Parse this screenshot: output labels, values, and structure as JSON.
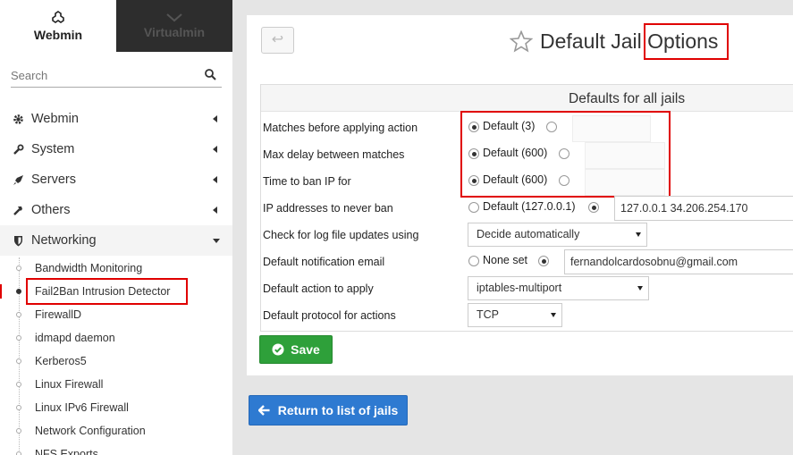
{
  "sidebar": {
    "switch": {
      "webmin_label": "Webmin",
      "virtualmin_label": "Virtualmin"
    },
    "search_placeholder": "Search",
    "menu": [
      {
        "label": "Webmin",
        "icon": "gear-icon"
      },
      {
        "label": "System",
        "icon": "wrench-icon"
      },
      {
        "label": "Servers",
        "icon": "rocket-icon"
      },
      {
        "label": "Others",
        "icon": "tools-icon"
      },
      {
        "label": "Networking",
        "icon": "shield-icon"
      }
    ],
    "submenu": [
      "Bandwidth Monitoring",
      "Fail2Ban Intrusion Detector",
      "FirewallD",
      "idmapd daemon",
      "Kerberos5",
      "Linux Firewall",
      "Linux IPv6 Firewall",
      "Network Configuration",
      "NFS Exports"
    ],
    "active_submenu": "Fail2Ban Intrusion Detector"
  },
  "header": {
    "back_icon": "↩",
    "title_part1": "Default Jail ",
    "title_part2": "Options"
  },
  "form": {
    "section_title": "Defaults for all jails",
    "rows": [
      {
        "label": "Matches before applying action",
        "default_option": "Default (3)",
        "selected": "default",
        "value": ""
      },
      {
        "label": "Max delay between matches",
        "default_option": "Default (600)",
        "selected": "default",
        "value": ""
      },
      {
        "label": "Time to ban IP for",
        "default_option": "Default (600)",
        "selected": "default",
        "value": ""
      },
      {
        "label": "IP addresses to never ban",
        "default_option": "Default (127.0.0.1)",
        "selected": "custom",
        "value": "127.0.0.1 34.206.254.170"
      },
      {
        "label": "Check for log file updates using",
        "select_value": "Decide automatically"
      },
      {
        "label": "Default notification email",
        "default_option": "None set",
        "selected": "custom",
        "value": "fernandolcardosobnu@gmail.com"
      },
      {
        "label": "Default action to apply",
        "select_value": "iptables-multiport"
      },
      {
        "label": "Default protocol for actions",
        "select_value": "TCP"
      }
    ],
    "save_label": "Save"
  },
  "return_label": "Return to list of jails",
  "colors": {
    "highlight_red": "#e00000",
    "save_green": "#2ea03a",
    "return_blue": "#2e7ad1",
    "virtualmin_dark": "#2d2d2d"
  }
}
